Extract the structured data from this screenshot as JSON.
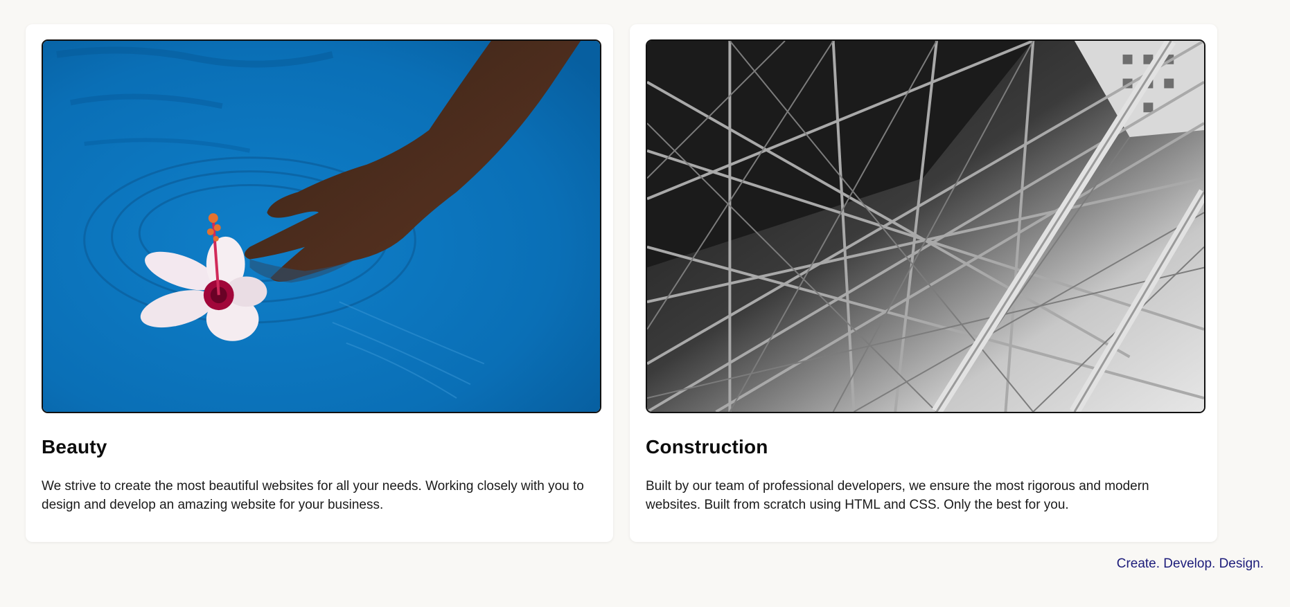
{
  "cards": [
    {
      "title": "Beauty",
      "text": "We strive to create the most beautiful websites for all your needs. Working closely with you to design and develop an amazing website for your business.",
      "image_subject": "hand-hibiscus-water-photo"
    },
    {
      "title": "Construction",
      "text": "Built by our team of professional developers, we ensure the most rigorous and modern websites. Built from scratch using HTML and CSS. Only the best for you.",
      "image_subject": "steel-truss-structure-photo"
    }
  ],
  "footer": {
    "tagline": "Create. Develop. Design."
  },
  "colors": {
    "page_background": "#f9f8f5",
    "card_background": "#ffffff",
    "tagline": "#1c1c7a",
    "water_blue": "#0a74bd"
  }
}
